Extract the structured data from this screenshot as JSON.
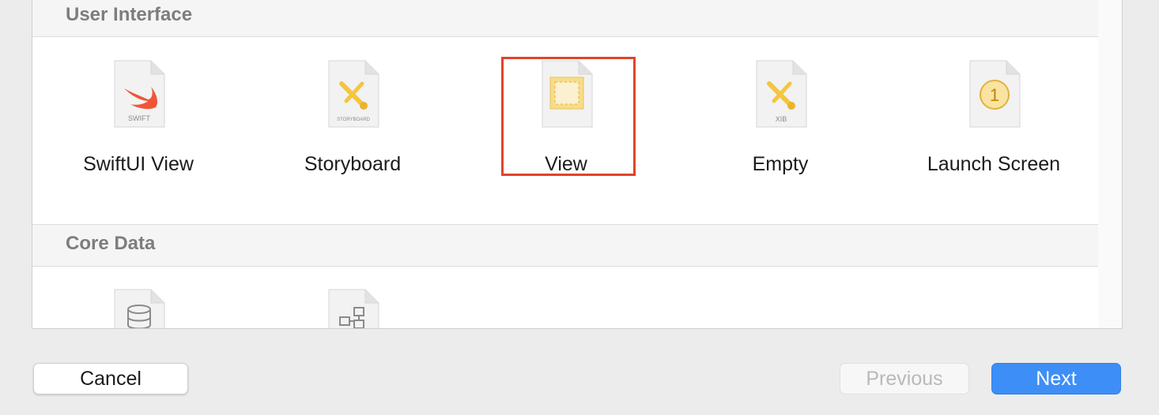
{
  "sections": [
    {
      "title": "User Interface",
      "items": [
        {
          "label": "SwiftUI View",
          "icon": "swift-file-icon",
          "badge": "SWIFT"
        },
        {
          "label": "Storyboard",
          "icon": "storyboard-file-icon",
          "badge": "STORYBOARD"
        },
        {
          "label": "View",
          "icon": "view-file-icon",
          "badge": "",
          "selected": true
        },
        {
          "label": "Empty",
          "icon": "xib-file-icon",
          "badge": "XIB"
        },
        {
          "label": "Launch Screen",
          "icon": "launch-screen-file-icon",
          "badge": "1"
        }
      ]
    },
    {
      "title": "Core Data",
      "items": [
        {
          "label": "",
          "icon": "data-model-file-icon"
        },
        {
          "label": "",
          "icon": "mapping-model-file-icon"
        }
      ]
    }
  ],
  "buttons": {
    "cancel": "Cancel",
    "previous": "Previous",
    "next": "Next"
  },
  "colors": {
    "accent": "#3d8ff7",
    "selection": "#e0442a",
    "swift": "#f0553a",
    "interface_builder": "#f5c53f"
  }
}
